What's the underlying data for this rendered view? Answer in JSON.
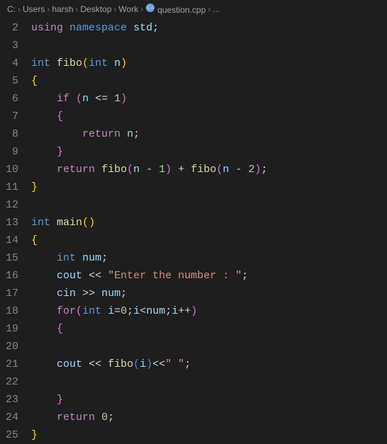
{
  "breadcrumb": {
    "items": [
      "C:",
      "Users",
      "harsh",
      "Desktop",
      "Work",
      "question.cpp",
      "..."
    ]
  },
  "editor": {
    "startLine": 2,
    "lines": [
      [
        {
          "t": "using",
          "c": "tok-control"
        },
        {
          "t": " ",
          "c": "tok-plain"
        },
        {
          "t": "namespace",
          "c": "tok-keyword"
        },
        {
          "t": " ",
          "c": "tok-plain"
        },
        {
          "t": "std",
          "c": "tok-var"
        },
        {
          "t": ";",
          "c": "tok-punc"
        }
      ],
      [],
      [
        {
          "t": "int",
          "c": "tok-type"
        },
        {
          "t": " ",
          "c": "tok-plain"
        },
        {
          "t": "fibo",
          "c": "tok-func"
        },
        {
          "t": "(",
          "c": "tok-brace1"
        },
        {
          "t": "int",
          "c": "tok-type"
        },
        {
          "t": " ",
          "c": "tok-plain"
        },
        {
          "t": "n",
          "c": "tok-var"
        },
        {
          "t": ")",
          "c": "tok-brace1"
        }
      ],
      [
        {
          "t": "{",
          "c": "tok-brace1"
        }
      ],
      [
        {
          "t": "    ",
          "c": "tok-plain"
        },
        {
          "t": "if",
          "c": "tok-control"
        },
        {
          "t": " ",
          "c": "tok-plain"
        },
        {
          "t": "(",
          "c": "tok-brace2"
        },
        {
          "t": "n",
          "c": "tok-var"
        },
        {
          "t": " ",
          "c": "tok-plain"
        },
        {
          "t": "<=",
          "c": "tok-op"
        },
        {
          "t": " ",
          "c": "tok-plain"
        },
        {
          "t": "1",
          "c": "tok-num"
        },
        {
          "t": ")",
          "c": "tok-brace2"
        }
      ],
      [
        {
          "t": "    ",
          "c": "tok-plain"
        },
        {
          "t": "{",
          "c": "tok-brace2"
        }
      ],
      [
        {
          "t": "        ",
          "c": "tok-plain"
        },
        {
          "t": "return",
          "c": "tok-control"
        },
        {
          "t": " ",
          "c": "tok-plain"
        },
        {
          "t": "n",
          "c": "tok-var"
        },
        {
          "t": ";",
          "c": "tok-punc"
        }
      ],
      [
        {
          "t": "    ",
          "c": "tok-plain"
        },
        {
          "t": "}",
          "c": "tok-brace2"
        }
      ],
      [
        {
          "t": "    ",
          "c": "tok-plain"
        },
        {
          "t": "return",
          "c": "tok-control"
        },
        {
          "t": " ",
          "c": "tok-plain"
        },
        {
          "t": "fibo",
          "c": "tok-func"
        },
        {
          "t": "(",
          "c": "tok-brace2"
        },
        {
          "t": "n",
          "c": "tok-var"
        },
        {
          "t": " ",
          "c": "tok-plain"
        },
        {
          "t": "-",
          "c": "tok-op"
        },
        {
          "t": " ",
          "c": "tok-plain"
        },
        {
          "t": "1",
          "c": "tok-num"
        },
        {
          "t": ")",
          "c": "tok-brace2"
        },
        {
          "t": " ",
          "c": "tok-plain"
        },
        {
          "t": "+",
          "c": "tok-op"
        },
        {
          "t": " ",
          "c": "tok-plain"
        },
        {
          "t": "fibo",
          "c": "tok-func"
        },
        {
          "t": "(",
          "c": "tok-brace2"
        },
        {
          "t": "n",
          "c": "tok-var"
        },
        {
          "t": " ",
          "c": "tok-plain"
        },
        {
          "t": "-",
          "c": "tok-op"
        },
        {
          "t": " ",
          "c": "tok-plain"
        },
        {
          "t": "2",
          "c": "tok-num"
        },
        {
          "t": ")",
          "c": "tok-brace2"
        },
        {
          "t": ";",
          "c": "tok-punc"
        }
      ],
      [
        {
          "t": "}",
          "c": "tok-brace1"
        }
      ],
      [],
      [
        {
          "t": "int",
          "c": "tok-type"
        },
        {
          "t": " ",
          "c": "tok-plain"
        },
        {
          "t": "main",
          "c": "tok-func"
        },
        {
          "t": "(",
          "c": "tok-brace1"
        },
        {
          "t": ")",
          "c": "tok-brace1"
        }
      ],
      [
        {
          "t": "{",
          "c": "tok-brace1"
        }
      ],
      [
        {
          "t": "    ",
          "c": "tok-plain"
        },
        {
          "t": "int",
          "c": "tok-type"
        },
        {
          "t": " ",
          "c": "tok-plain"
        },
        {
          "t": "num",
          "c": "tok-var"
        },
        {
          "t": ";",
          "c": "tok-punc"
        }
      ],
      [
        {
          "t": "    ",
          "c": "tok-plain"
        },
        {
          "t": "cout",
          "c": "tok-var"
        },
        {
          "t": " ",
          "c": "tok-plain"
        },
        {
          "t": "<<",
          "c": "tok-op"
        },
        {
          "t": " ",
          "c": "tok-plain"
        },
        {
          "t": "\"Enter the number : \"",
          "c": "tok-str"
        },
        {
          "t": ";",
          "c": "tok-punc"
        }
      ],
      [
        {
          "t": "    ",
          "c": "tok-plain"
        },
        {
          "t": "cin",
          "c": "tok-var"
        },
        {
          "t": " ",
          "c": "tok-plain"
        },
        {
          "t": ">>",
          "c": "tok-op"
        },
        {
          "t": " ",
          "c": "tok-plain"
        },
        {
          "t": "num",
          "c": "tok-var"
        },
        {
          "t": ";",
          "c": "tok-punc"
        }
      ],
      [
        {
          "t": "    ",
          "c": "tok-plain"
        },
        {
          "t": "for",
          "c": "tok-control"
        },
        {
          "t": "(",
          "c": "tok-brace2"
        },
        {
          "t": "int",
          "c": "tok-type"
        },
        {
          "t": " ",
          "c": "tok-plain"
        },
        {
          "t": "i",
          "c": "tok-var"
        },
        {
          "t": "=",
          "c": "tok-op"
        },
        {
          "t": "0",
          "c": "tok-num"
        },
        {
          "t": ";",
          "c": "tok-punc"
        },
        {
          "t": "i",
          "c": "tok-var"
        },
        {
          "t": "<",
          "c": "tok-op"
        },
        {
          "t": "num",
          "c": "tok-var"
        },
        {
          "t": ";",
          "c": "tok-punc"
        },
        {
          "t": "i",
          "c": "tok-var"
        },
        {
          "t": "++",
          "c": "tok-op"
        },
        {
          "t": ")",
          "c": "tok-brace2"
        }
      ],
      [
        {
          "t": "    ",
          "c": "tok-plain"
        },
        {
          "t": "{",
          "c": "tok-brace2"
        }
      ],
      [],
      [
        {
          "t": "    ",
          "c": "tok-plain"
        },
        {
          "t": "cout",
          "c": "tok-var"
        },
        {
          "t": " ",
          "c": "tok-plain"
        },
        {
          "t": "<<",
          "c": "tok-op"
        },
        {
          "t": " ",
          "c": "tok-plain"
        },
        {
          "t": "fibo",
          "c": "tok-func"
        },
        {
          "t": "(",
          "c": "tok-brace3"
        },
        {
          "t": "i",
          "c": "tok-var"
        },
        {
          "t": ")",
          "c": "tok-brace3"
        },
        {
          "t": "<<",
          "c": "tok-op"
        },
        {
          "t": "\" \"",
          "c": "tok-str"
        },
        {
          "t": ";",
          "c": "tok-punc"
        }
      ],
      [],
      [
        {
          "t": "    ",
          "c": "tok-plain"
        },
        {
          "t": "}",
          "c": "tok-brace2"
        }
      ],
      [
        {
          "t": "    ",
          "c": "tok-plain"
        },
        {
          "t": "return",
          "c": "tok-control"
        },
        {
          "t": " ",
          "c": "tok-plain"
        },
        {
          "t": "0",
          "c": "tok-num"
        },
        {
          "t": ";",
          "c": "tok-punc"
        }
      ],
      [
        {
          "t": "}",
          "c": "tok-brace1"
        }
      ]
    ]
  }
}
